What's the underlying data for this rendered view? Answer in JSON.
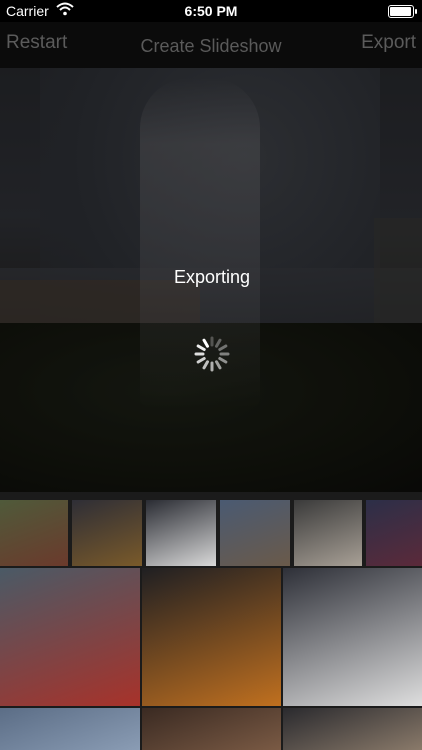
{
  "status_bar": {
    "carrier": "Carrier",
    "time": "6:50 PM",
    "wifi_icon": "wifi-icon",
    "battery_icon": "battery-icon",
    "battery_level": 0.95
  },
  "nav": {
    "left_label": "Restart",
    "title": "Create Slideshow",
    "right_label": "Export"
  },
  "preview": {
    "overlay_text": "Exporting",
    "spinner_icon": "activity-spinner-icon"
  },
  "thumbnails": [
    {
      "name": "thumb-man-on-balcony",
      "colors": [
        "#4f5a3a",
        "#6b3a2c"
      ]
    },
    {
      "name": "thumb-sunset-sea",
      "colors": [
        "#2e2e36",
        "#7a5a2a"
      ]
    },
    {
      "name": "thumb-doctor-coat",
      "colors": [
        "#2a2c33",
        "#d9d9d9"
      ]
    },
    {
      "name": "thumb-coastal-town",
      "colors": [
        "#4a5a72",
        "#6a5a4a"
      ]
    },
    {
      "name": "thumb-man-with-kids",
      "colors": [
        "#3a3a3a",
        "#a8a096"
      ]
    },
    {
      "name": "thumb-group-photo",
      "colors": [
        "#2c2f48",
        "#5b2a3a"
      ]
    },
    {
      "name": "thumb-man-red-shirt-large",
      "colors": [
        "#4a5a66",
        "#a8322a"
      ]
    },
    {
      "name": "thumb-sunset-large",
      "colors": [
        "#1f1f22",
        "#c0701f"
      ]
    },
    {
      "name": "thumb-doctor-large",
      "colors": [
        "#2e3038",
        "#dedede"
      ]
    },
    {
      "name": "thumb-row3-a",
      "colors": [
        "#5b6d86",
        "#8a9cb4"
      ]
    },
    {
      "name": "thumb-row3-b",
      "colors": [
        "#3a2a22",
        "#7a5a44"
      ]
    },
    {
      "name": "thumb-row3-c",
      "colors": [
        "#2a2a2e",
        "#8a7a6a"
      ]
    }
  ]
}
